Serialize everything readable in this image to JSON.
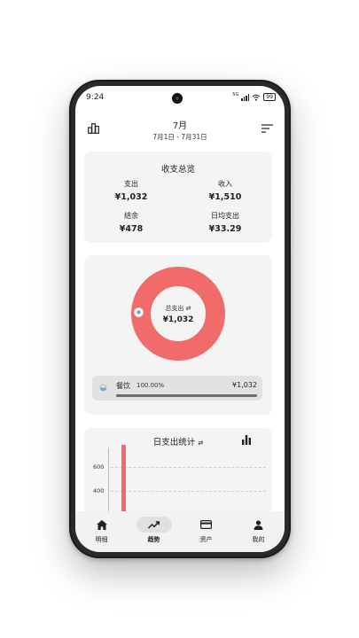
{
  "status_bar": {
    "time": "9:24",
    "network": "5G",
    "battery": "99"
  },
  "header": {
    "month": "7月",
    "range": "7月1日 - 7月31日"
  },
  "overview": {
    "title": "收支总览",
    "expense_label": "支出",
    "expense_value": "¥1,032",
    "income_label": "收入",
    "income_value": "¥1,510",
    "balance_label": "结余",
    "balance_value": "¥478",
    "daily_avg_label": "日均支出",
    "daily_avg_value": "¥33.29"
  },
  "donut": {
    "center_label": "总支出",
    "center_value": "¥1,032",
    "color": "#f26b6b",
    "categories": [
      {
        "name": "餐饮",
        "percent": "100.00%",
        "amount": "¥1,032",
        "fraction": 1.0,
        "icon": "rice-bowl-icon"
      }
    ]
  },
  "daily": {
    "title": "日支出统计",
    "y_ticks": [
      "600",
      "400"
    ],
    "bar_color": "#f26b6b"
  },
  "nav": {
    "items": [
      {
        "label": "明细",
        "icon": "home-icon"
      },
      {
        "label": "趋势",
        "icon": "trend-icon"
      },
      {
        "label": "资产",
        "icon": "card-icon"
      },
      {
        "label": "我的",
        "icon": "person-icon"
      }
    ],
    "active": "趋势"
  },
  "colors": {
    "accent": "#f26b6b",
    "card_bg": "#f4f4f4",
    "nav_bg": "#f2f2f2"
  }
}
